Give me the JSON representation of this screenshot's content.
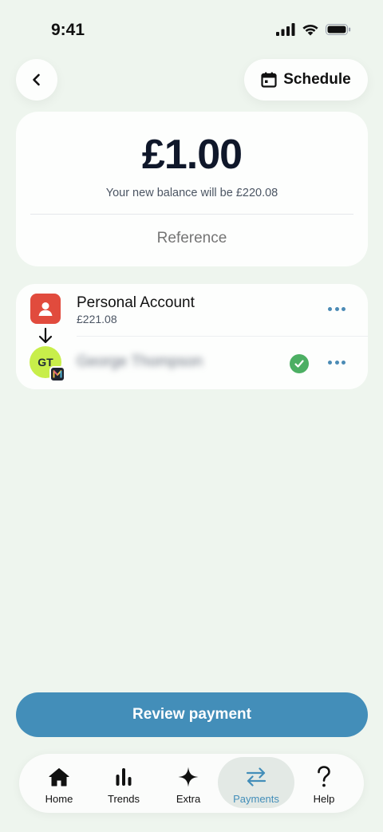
{
  "status_bar": {
    "time": "9:41"
  },
  "header": {
    "schedule_label": "Schedule"
  },
  "amount": {
    "value": "£1.00",
    "balance_note": "Your new balance will be £220.08",
    "reference_placeholder": "Reference"
  },
  "from_account": {
    "name": "Personal Account",
    "balance": "£221.08"
  },
  "to_account": {
    "initials": "GT",
    "name": "George Thompson"
  },
  "review_button": "Review payment",
  "tabs": [
    {
      "label": "Home",
      "icon": "home-icon"
    },
    {
      "label": "Trends",
      "icon": "bar-chart-icon"
    },
    {
      "label": "Extra",
      "icon": "sparkle-icon"
    },
    {
      "label": "Payments",
      "icon": "transfer-arrows-icon",
      "active": true
    },
    {
      "label": "Help",
      "icon": "question-icon"
    }
  ],
  "colors": {
    "background": "#eef5ee",
    "accent": "#438eb9",
    "from_avatar": "#e14b3d",
    "to_avatar": "#c8ee4a",
    "verified": "#4caf63"
  }
}
